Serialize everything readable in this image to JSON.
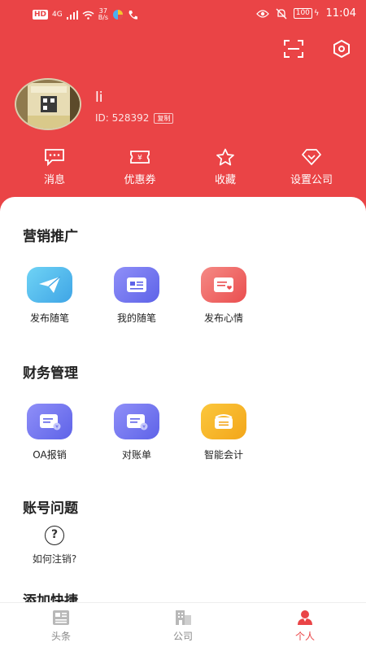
{
  "status_bar": {
    "left_tag": "HD",
    "network": "4G",
    "speed_value": "37",
    "speed_unit": "B/s",
    "battery": "100",
    "time": "11:04"
  },
  "profile": {
    "username": "li",
    "id_text": "ID: 528392",
    "copy_label": "复制"
  },
  "quick_actions": [
    {
      "label": "消息",
      "icon": "message-icon"
    },
    {
      "label": "优惠券",
      "icon": "coupon-icon"
    },
    {
      "label": "收藏",
      "icon": "star-icon"
    },
    {
      "label": "设置公司",
      "icon": "diamond-icon"
    }
  ],
  "sections": {
    "marketing": {
      "title": "营销推广",
      "items": [
        {
          "label": "发布随笔",
          "icon": "paper-plane-icon",
          "color": "#3fa5e6"
        },
        {
          "label": "我的随笔",
          "icon": "notes-icon",
          "color": "#5e63e8"
        },
        {
          "label": "发布心情",
          "icon": "mood-note-icon",
          "color": "#ea4e4f"
        }
      ]
    },
    "finance": {
      "title": "财务管理",
      "items": [
        {
          "label": "OA报销",
          "icon": "reimburse-icon",
          "color": "#5e63e8"
        },
        {
          "label": "对账单",
          "icon": "statement-icon",
          "color": "#5e63e8"
        },
        {
          "label": "智能会计",
          "icon": "wallet-icon",
          "color": "#f3a61a"
        }
      ]
    },
    "account": {
      "title": "账号问题",
      "help_label": "如何注销?"
    },
    "shortcut": {
      "title": "添加快捷"
    }
  },
  "tabbar": [
    {
      "label": "头条",
      "icon": "news-icon",
      "active": false
    },
    {
      "label": "公司",
      "icon": "building-icon",
      "active": false
    },
    {
      "label": "个人",
      "icon": "person-icon",
      "active": true
    }
  ],
  "colors": {
    "brand": "#ea4446",
    "active_tab": "#ea4446"
  }
}
